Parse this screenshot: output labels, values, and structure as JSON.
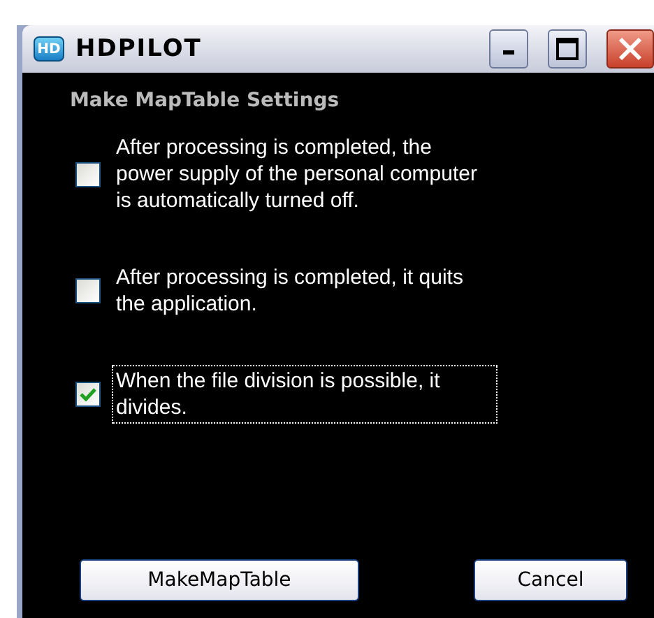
{
  "window": {
    "icon_text": "HD",
    "title": "HDPILOT"
  },
  "heading": "Make MapTable Settings",
  "options": [
    {
      "label": "After processing is completed, the power supply of the personal computer is automatically turned off.",
      "checked": false,
      "focused": false
    },
    {
      "label": "After processing is completed, it quits the application.",
      "checked": false,
      "focused": false
    },
    {
      "label": "When the file division is possible, it divides.",
      "checked": true,
      "focused": true
    }
  ],
  "buttons": [
    "MakeMapTable",
    "Cancel"
  ]
}
